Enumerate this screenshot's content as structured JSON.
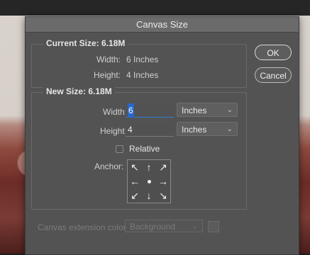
{
  "window": {
    "title": "Canvas Size"
  },
  "buttons": {
    "ok": "OK",
    "cancel": "Cancel"
  },
  "current_size": {
    "title": "Current Size: 6.18M",
    "width_label": "Width:",
    "width_value": "6 Inches",
    "height_label": "Height:",
    "height_value": "4 Inches"
  },
  "new_size": {
    "title": "New Size: 6.18M",
    "width_label": "Width:",
    "width_value": "6",
    "width_unit": "Inches",
    "height_label": "Height:",
    "height_value": "4",
    "height_unit": "Inches",
    "relative_label": "Relative",
    "relative_checked": false,
    "anchor_label": "Anchor:",
    "anchor_arrows": [
      "↖",
      "↑",
      "↗",
      "←",
      "•",
      "→",
      "↙",
      "↓",
      "↘"
    ]
  },
  "extension": {
    "label": "Canvas extension color:",
    "value": "Background"
  },
  "colors": {
    "dialog_bg": "#535353",
    "accent_selection": "#2a67c8"
  }
}
